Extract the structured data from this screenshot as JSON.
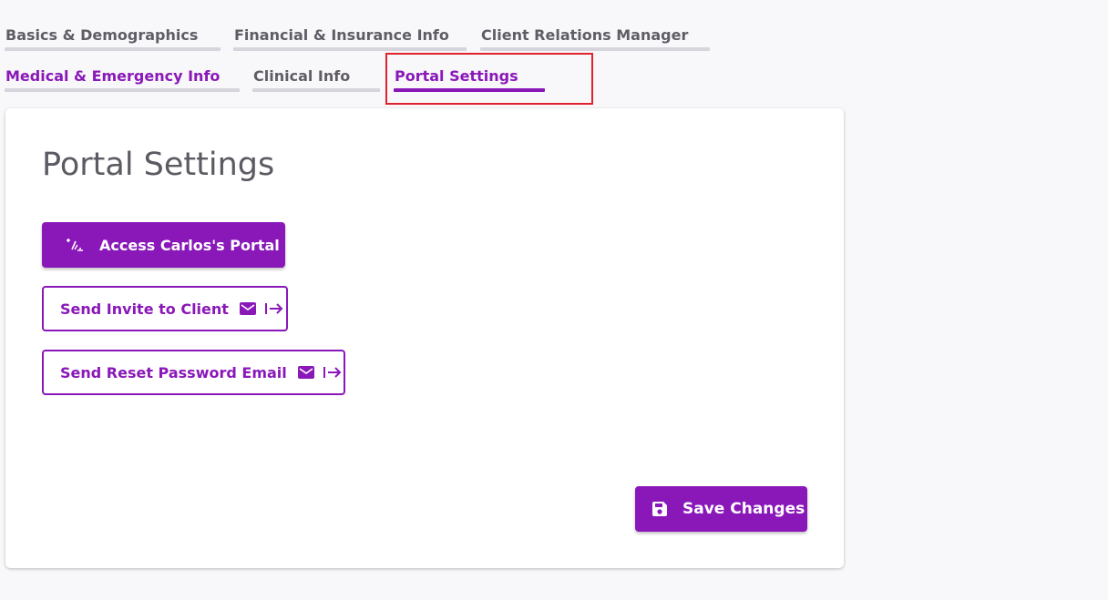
{
  "tabs": [
    {
      "label": "Basics & Demographics"
    },
    {
      "label": "Financial & Insurance Info"
    },
    {
      "label": "Client Relations Manager"
    },
    {
      "label": "Medical & Emergency Info"
    },
    {
      "label": "Clinical Info"
    },
    {
      "label": "Portal Settings"
    }
  ],
  "active_tab": "Portal Settings",
  "card": {
    "title": "Portal Settings",
    "access_portal_label": "Access Carlos's Portal",
    "send_invite_label": "Send Invite to Client",
    "send_reset_label": "Send Reset Password Email",
    "save_label": "Save Changes"
  },
  "icons": {
    "access": "portal-access-icon",
    "mail": "mail-icon",
    "send": "arrow-right-to-bar-icon",
    "save": "floppy-disk-icon"
  },
  "colors": {
    "accent": "#8a18b9",
    "tab_inactive_text": "#5e5e66",
    "tab_bar": "#d6d4dc",
    "highlight_box": "#e0222c",
    "background": "#f8f7f9"
  }
}
